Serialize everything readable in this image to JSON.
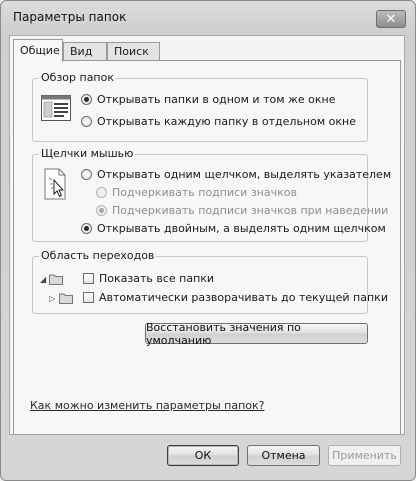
{
  "window": {
    "title": "Параметры папок"
  },
  "tabs": [
    {
      "label": "Общие",
      "active": true
    },
    {
      "label": "Вид",
      "active": false
    },
    {
      "label": "Поиск",
      "active": false
    }
  ],
  "browse_folders": {
    "legend": "Обзор папок",
    "options": [
      {
        "label": "Открывать папки в одном и том же окне",
        "checked": true
      },
      {
        "label": "Открывать каждую папку в отдельном окне",
        "checked": false
      }
    ]
  },
  "click_items": {
    "legend": "Щелчки мышью",
    "single_click": {
      "label": "Открывать одним щелчком, выделять указателем",
      "checked": false
    },
    "underline_always": {
      "label": "Подчеркивать подписи значков",
      "checked": false,
      "enabled": false
    },
    "underline_hover": {
      "label": "Подчеркивать подписи значков при наведении",
      "checked": true,
      "enabled": false
    },
    "double_click": {
      "label": "Открывать двойным, а выделять одним щелчком",
      "checked": true
    }
  },
  "navigation_pane": {
    "legend": "Область переходов",
    "show_all_folders": {
      "label": "Показать все папки",
      "checked": false
    },
    "auto_expand": {
      "label": "Автоматически разворачивать до текущей папки",
      "checked": false
    }
  },
  "restore_defaults_label": "Восстановить значения по умолчанию",
  "help_link": "Как можно изменить параметры папок?",
  "buttons": {
    "ok": "ОК",
    "cancel": "Отмена",
    "apply": "Применить"
  }
}
